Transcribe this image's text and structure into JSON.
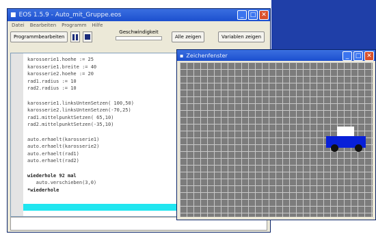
{
  "main_window": {
    "title": "EOS 1.5.9 - Auto_mit_Gruppe.eos",
    "menu": [
      "Datei",
      "Bearbeiten",
      "Programm",
      "Hilfe"
    ],
    "toolbar": {
      "program_editor_label": "Programmbearbeiten",
      "speed_label": "Geschwindigkeit",
      "show_all_label": "Alle zeigen",
      "show_variables_label": "Variablen zeigen"
    },
    "code_lines": [
      "karosserie1.hoehe := 25",
      "karosserie1.breite := 40",
      "karosserie2.hoehe := 20",
      "rad1.radius := 10",
      "rad2.radius := 10",
      "",
      "karosserie1.linksUntenSetzen( 100,50)",
      "karosserie2.linksUntenSetzen(-70,25)",
      "rad1.mittelpunktSetzen( 65,10)",
      "rad2.mittelpunktSetzen(-35,10)",
      "",
      "auto.erhaelt(karosserie1)",
      "auto.erhaelt(karosserie2)",
      "auto.erhaelt(rad1)",
      "auto.erhaelt(rad2)",
      "",
      "wiederhole 92 mal",
      "   auto.verschieben(3,0)",
      "*wiederhole"
    ]
  },
  "draw_window": {
    "title": "Zeichenfenster"
  },
  "colors": {
    "titlebar": "#1c4fcf",
    "canvas_background": "#7c7c7c",
    "car_body": "#0820d8",
    "car_top": "#ffffff",
    "wheel": "#111111",
    "status_bar": "#20e6f0"
  }
}
